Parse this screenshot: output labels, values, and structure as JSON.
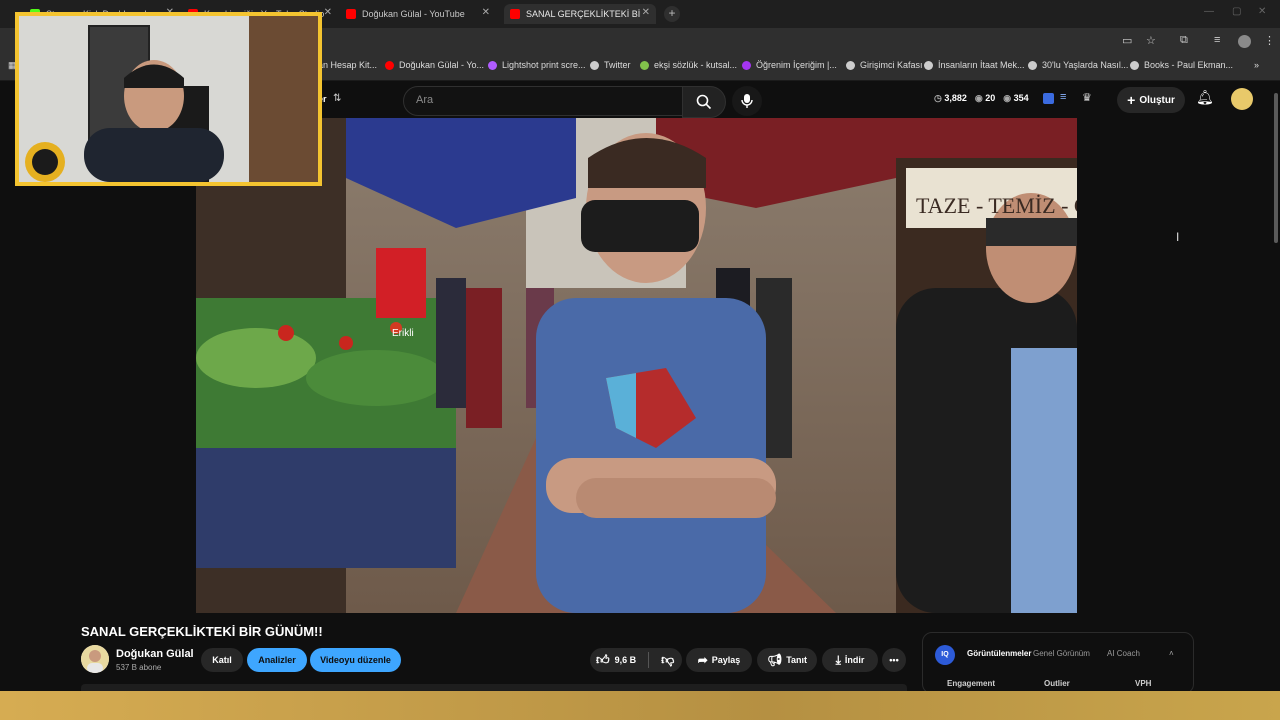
{
  "browser": {
    "tabs": [
      {
        "label": "Stream - Kick Dashboard",
        "fav_color": "#53fc18"
      },
      {
        "label": "Kanal içeriği - YouTube Studio",
        "fav_color": "#ff0000"
      },
      {
        "label": "Doğukan Gülal - YouTube",
        "fav_color": "#ff0000"
      },
      {
        "label": "SANAL GERÇEKLİKTEKİ BİR GÜN",
        "fav_color": "#ff0000"
      }
    ],
    "new_tab": "+",
    "bookmarks": [
      {
        "label": "an Hesap Kit...",
        "color": "#888888"
      },
      {
        "label": "Doğukan Gülal - Yo...",
        "color": "#ff0000"
      },
      {
        "label": "Lightshot print scre...",
        "color": "#b05cff"
      },
      {
        "label": "Twitter",
        "color": "#cccccc"
      },
      {
        "label": "ekşi sözlük - kutsal...",
        "color": "#81c14b"
      },
      {
        "label": "Öğrenim İçeriğim |...",
        "color": "#a435f0"
      },
      {
        "label": "Girişimci Kafası",
        "color": "#cccccc"
      },
      {
        "label": "İnsanların İtaat Mek...",
        "color": "#cccccc"
      },
      {
        "label": "30'lu Yaşlarda Nasıl...",
        "color": "#cccccc"
      },
      {
        "label": "Books - Paul Ekman...",
        "color": "#cccccc"
      }
    ],
    "more_bookmarks": "»"
  },
  "youtube": {
    "filter_label": "er",
    "search_placeholder": "Ara",
    "stats": {
      "views": "3,882",
      "likes": "20",
      "viewers": "354"
    },
    "create_label": "Oluştur"
  },
  "video": {
    "title": "SANAL GERÇEKLİKTEKİ BİR GÜNÜM!!",
    "sign_text": "TAZE - TEMİZ - GÜVE",
    "erikli_text": "Erikli"
  },
  "channel": {
    "name": "Doğukan Gülal",
    "subscribers": "537 B abone",
    "join_label": "Katıl",
    "analytics_label": "Analizler",
    "edit_label": "Videoyu düzenle"
  },
  "actions": {
    "likes": "9,6 B",
    "share_label": "Paylaş",
    "promote_label": "Tanıt",
    "download_label": "İndir"
  },
  "vidiq": {
    "logo": "IQ",
    "tabs": [
      "Görüntülenmeler",
      "Genel Görünüm",
      "AI Coach"
    ],
    "columns": [
      "Engagement",
      "Outlier",
      "VPH"
    ]
  }
}
